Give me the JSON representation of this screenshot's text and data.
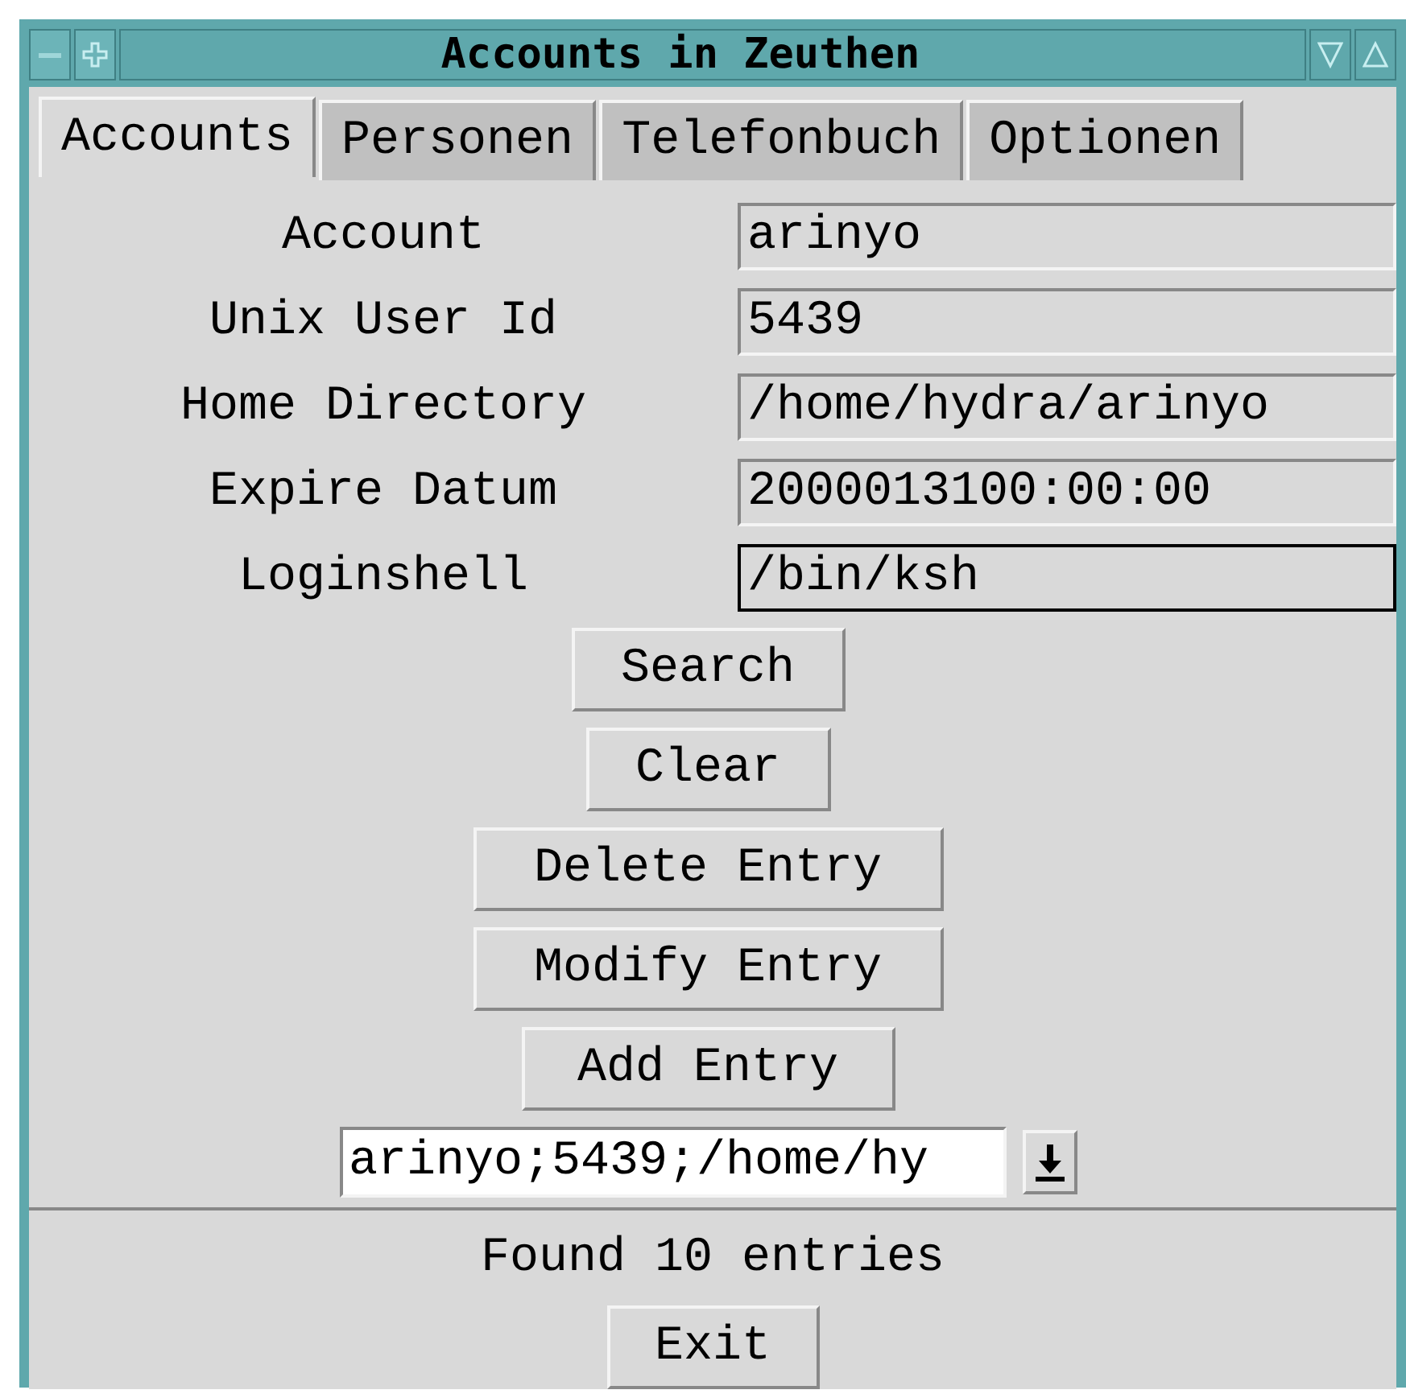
{
  "window": {
    "title": "Accounts in Zeuthen"
  },
  "tabs": [
    {
      "label": "Accounts",
      "selected": true
    },
    {
      "label": "Personen",
      "selected": false
    },
    {
      "label": "Telefonbuch",
      "selected": false
    },
    {
      "label": "Optionen",
      "selected": false
    }
  ],
  "fields": [
    {
      "label": "Account",
      "value": "arinyo",
      "focused": false
    },
    {
      "label": "Unix User Id",
      "value": "5439",
      "focused": false
    },
    {
      "label": "Home Directory",
      "value": "/home/hydra/arinyo",
      "focused": false
    },
    {
      "label": "Expire Datum",
      "value": "2000013100:00:00",
      "focused": false
    },
    {
      "label": "Loginshell",
      "value": "/bin/ksh",
      "focused": true
    }
  ],
  "buttons": [
    "Search",
    "Clear",
    "Delete Entry",
    "Modify Entry",
    "Add Entry"
  ],
  "result_combo": {
    "value": "arinyo;5439;/home/hy"
  },
  "status": "Found 10 entries",
  "exit_button": "Exit"
}
